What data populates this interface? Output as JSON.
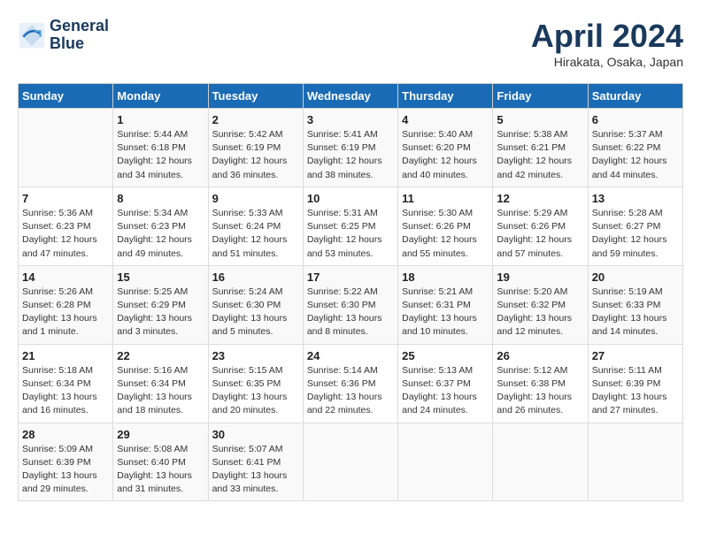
{
  "header": {
    "logo_line1": "General",
    "logo_line2": "Blue",
    "month_title": "April 2024",
    "location": "Hirakata, Osaka, Japan"
  },
  "weekdays": [
    "Sunday",
    "Monday",
    "Tuesday",
    "Wednesday",
    "Thursday",
    "Friday",
    "Saturday"
  ],
  "weeks": [
    [
      {
        "day": "",
        "info": ""
      },
      {
        "day": "1",
        "info": "Sunrise: 5:44 AM\nSunset: 6:18 PM\nDaylight: 12 hours\nand 34 minutes."
      },
      {
        "day": "2",
        "info": "Sunrise: 5:42 AM\nSunset: 6:19 PM\nDaylight: 12 hours\nand 36 minutes."
      },
      {
        "day": "3",
        "info": "Sunrise: 5:41 AM\nSunset: 6:19 PM\nDaylight: 12 hours\nand 38 minutes."
      },
      {
        "day": "4",
        "info": "Sunrise: 5:40 AM\nSunset: 6:20 PM\nDaylight: 12 hours\nand 40 minutes."
      },
      {
        "day": "5",
        "info": "Sunrise: 5:38 AM\nSunset: 6:21 PM\nDaylight: 12 hours\nand 42 minutes."
      },
      {
        "day": "6",
        "info": "Sunrise: 5:37 AM\nSunset: 6:22 PM\nDaylight: 12 hours\nand 44 minutes."
      }
    ],
    [
      {
        "day": "7",
        "info": "Sunrise: 5:36 AM\nSunset: 6:23 PM\nDaylight: 12 hours\nand 47 minutes."
      },
      {
        "day": "8",
        "info": "Sunrise: 5:34 AM\nSunset: 6:23 PM\nDaylight: 12 hours\nand 49 minutes."
      },
      {
        "day": "9",
        "info": "Sunrise: 5:33 AM\nSunset: 6:24 PM\nDaylight: 12 hours\nand 51 minutes."
      },
      {
        "day": "10",
        "info": "Sunrise: 5:31 AM\nSunset: 6:25 PM\nDaylight: 12 hours\nand 53 minutes."
      },
      {
        "day": "11",
        "info": "Sunrise: 5:30 AM\nSunset: 6:26 PM\nDaylight: 12 hours\nand 55 minutes."
      },
      {
        "day": "12",
        "info": "Sunrise: 5:29 AM\nSunset: 6:26 PM\nDaylight: 12 hours\nand 57 minutes."
      },
      {
        "day": "13",
        "info": "Sunrise: 5:28 AM\nSunset: 6:27 PM\nDaylight: 12 hours\nand 59 minutes."
      }
    ],
    [
      {
        "day": "14",
        "info": "Sunrise: 5:26 AM\nSunset: 6:28 PM\nDaylight: 13 hours\nand 1 minute."
      },
      {
        "day": "15",
        "info": "Sunrise: 5:25 AM\nSunset: 6:29 PM\nDaylight: 13 hours\nand 3 minutes."
      },
      {
        "day": "16",
        "info": "Sunrise: 5:24 AM\nSunset: 6:30 PM\nDaylight: 13 hours\nand 5 minutes."
      },
      {
        "day": "17",
        "info": "Sunrise: 5:22 AM\nSunset: 6:30 PM\nDaylight: 13 hours\nand 8 minutes."
      },
      {
        "day": "18",
        "info": "Sunrise: 5:21 AM\nSunset: 6:31 PM\nDaylight: 13 hours\nand 10 minutes."
      },
      {
        "day": "19",
        "info": "Sunrise: 5:20 AM\nSunset: 6:32 PM\nDaylight: 13 hours\nand 12 minutes."
      },
      {
        "day": "20",
        "info": "Sunrise: 5:19 AM\nSunset: 6:33 PM\nDaylight: 13 hours\nand 14 minutes."
      }
    ],
    [
      {
        "day": "21",
        "info": "Sunrise: 5:18 AM\nSunset: 6:34 PM\nDaylight: 13 hours\nand 16 minutes."
      },
      {
        "day": "22",
        "info": "Sunrise: 5:16 AM\nSunset: 6:34 PM\nDaylight: 13 hours\nand 18 minutes."
      },
      {
        "day": "23",
        "info": "Sunrise: 5:15 AM\nSunset: 6:35 PM\nDaylight: 13 hours\nand 20 minutes."
      },
      {
        "day": "24",
        "info": "Sunrise: 5:14 AM\nSunset: 6:36 PM\nDaylight: 13 hours\nand 22 minutes."
      },
      {
        "day": "25",
        "info": "Sunrise: 5:13 AM\nSunset: 6:37 PM\nDaylight: 13 hours\nand 24 minutes."
      },
      {
        "day": "26",
        "info": "Sunrise: 5:12 AM\nSunset: 6:38 PM\nDaylight: 13 hours\nand 26 minutes."
      },
      {
        "day": "27",
        "info": "Sunrise: 5:11 AM\nSunset: 6:39 PM\nDaylight: 13 hours\nand 27 minutes."
      }
    ],
    [
      {
        "day": "28",
        "info": "Sunrise: 5:09 AM\nSunset: 6:39 PM\nDaylight: 13 hours\nand 29 minutes."
      },
      {
        "day": "29",
        "info": "Sunrise: 5:08 AM\nSunset: 6:40 PM\nDaylight: 13 hours\nand 31 minutes."
      },
      {
        "day": "30",
        "info": "Sunrise: 5:07 AM\nSunset: 6:41 PM\nDaylight: 13 hours\nand 33 minutes."
      },
      {
        "day": "",
        "info": ""
      },
      {
        "day": "",
        "info": ""
      },
      {
        "day": "",
        "info": ""
      },
      {
        "day": "",
        "info": ""
      }
    ]
  ]
}
